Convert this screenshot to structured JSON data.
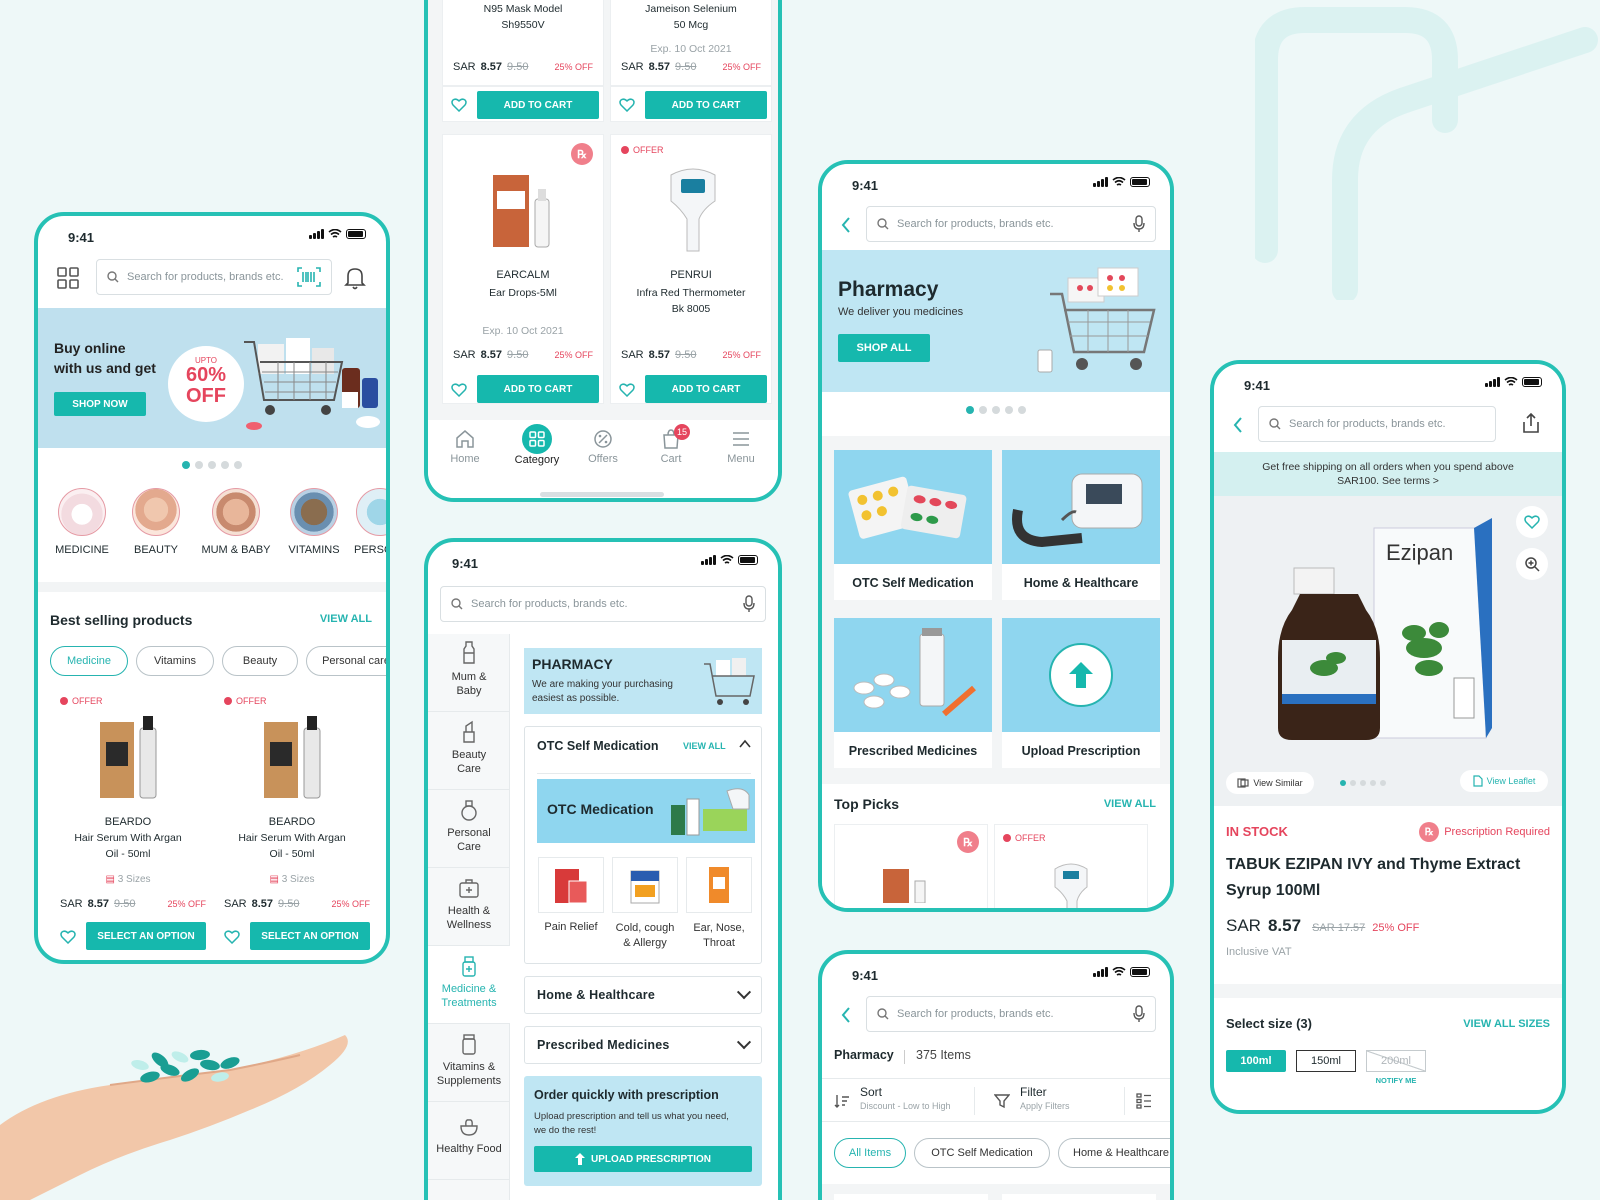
{
  "status_time": "9:41",
  "search_placeholder": "Search for products, brands etc.",
  "home": {
    "banner": {
      "line1": "Buy online",
      "line2": "with us and get",
      "upto": "UPTO",
      "pct": "60%",
      "off": "OFF",
      "button": "SHOP NOW"
    },
    "categories": [
      "MEDICINE",
      "BEAUTY",
      "MUM & BABY",
      "VITAMINS",
      "PERSO"
    ],
    "best_selling": {
      "title": "Best selling products",
      "view_all": "VIEW ALL"
    },
    "chips": [
      "Medicine",
      "Vitamins",
      "Beauty",
      "Personal care"
    ],
    "products": [
      {
        "offer": "OFFER",
        "brand": "BEARDO",
        "name1": "Hair Serum With Argan",
        "name2": "Oil - 50ml",
        "sizes": "3 Sizes",
        "currency": "SAR",
        "price": "8.57",
        "old": "9.50",
        "off": "25% OFF",
        "button": "SELECT AN OPTION"
      },
      {
        "offer": "OFFER",
        "brand": "BEARDO",
        "name1": "Hair Serum With Argan",
        "name2": "Oil - 50ml",
        "sizes": "3 Sizes",
        "currency": "SAR",
        "price": "8.57",
        "old": "9.50",
        "off": "25% OFF",
        "button": "SELECT AN OPTION"
      }
    ]
  },
  "grid": {
    "top": [
      {
        "name1": "N95 Mask Model",
        "name2": "Sh9550V",
        "exp": "",
        "currency": "SAR",
        "price": "8.57",
        "old": "9.50",
        "off": "25% OFF",
        "button": "ADD TO CART"
      },
      {
        "name1": "Jameison Selenium",
        "name2": "50 Mcg",
        "exp": "Exp. 10 Oct 2021",
        "currency": "SAR",
        "price": "8.57",
        "old": "9.50",
        "off": "25% OFF",
        "button": "ADD TO CART"
      }
    ],
    "bottom": [
      {
        "badge": "℞",
        "brand": "EARCALM",
        "name1": "Ear Drops-5Ml",
        "name2": "",
        "exp": "Exp. 10 Oct 2021",
        "currency": "SAR",
        "price": "8.57",
        "old": "9.50",
        "off": "25% OFF",
        "button": "ADD TO CART"
      },
      {
        "offer": "OFFER",
        "brand": "PENRUI",
        "name1": "Infra Red Thermometer",
        "name2": "Bk 8005",
        "exp": "",
        "currency": "SAR",
        "price": "8.57",
        "old": "9.50",
        "off": "25% OFF",
        "button": "ADD TO CART"
      }
    ],
    "nav": [
      "Home",
      "Category",
      "Offers",
      "Cart",
      "Menu"
    ],
    "cart_count": "15"
  },
  "category": {
    "sidebar": [
      {
        "l1": "Mum &",
        "l2": "Baby"
      },
      {
        "l1": "Beauty",
        "l2": "Care"
      },
      {
        "l1": "Personal",
        "l2": "Care"
      },
      {
        "l1": "Health &",
        "l2": "Wellness"
      },
      {
        "l1": "Medicine &",
        "l2": "Treatments"
      },
      {
        "l1": "Vitamins &",
        "l2": "Supplements"
      },
      {
        "l1": "Healthy Food",
        "l2": ""
      }
    ],
    "pharmacy_title": "PHARMACY",
    "pharmacy_sub1": "We are making your purchasing",
    "pharmacy_sub2": "easiest as possible.",
    "otc_header": "OTC Self Medication",
    "view_all": "VIEW ALL",
    "otc_banner": "OTC Medication",
    "subcats": [
      {
        "l1": "Pain Relief",
        "l2": ""
      },
      {
        "l1": "Cold, cough",
        "l2": "& Allergy"
      },
      {
        "l1": "Ear, Nose,",
        "l2": "Throat"
      }
    ],
    "accordion": [
      "Home & Healthcare",
      "Prescribed Medicines"
    ],
    "rx_title": "Order quickly with prescription",
    "rx_sub1": "Upload prescription and tell us what you need,",
    "rx_sub2": "we do the rest!",
    "rx_button": "UPLOAD PRESCRIPTION"
  },
  "pharmacy": {
    "title": "Pharmacy",
    "sub": "We deliver you medicines",
    "button": "SHOP ALL",
    "tiles": [
      "OTC Self Medication",
      "Home & Healthcare",
      "Prescribed Medicines",
      "Upload Prescription"
    ],
    "top_picks": "Top Picks",
    "view_all": "VIEW ALL",
    "offer": "OFFER"
  },
  "listing": {
    "title": "Pharmacy",
    "count": "375 Items",
    "sort": "Sort",
    "sort_sub": "Discount - Low to High",
    "filter": "Filter",
    "filter_sub": "Apply Filters",
    "chips": [
      "All Items",
      "OTC Self Medication",
      "Home & Healthcare"
    ]
  },
  "product": {
    "shipping1": "Get free shipping on all orders when you spend above",
    "shipping2": "SAR100. See terms >",
    "view_similar": "View Similar",
    "view_leaflet": "View Leaflet",
    "stock": "IN STOCK",
    "rx": "Prescription Required",
    "name1": "TABUK EZIPAN IVY and Thyme Extract",
    "name2": "Syrup 100Ml",
    "currency": "SAR",
    "price": "8.57",
    "old": "SAR 17.57",
    "off": "25% OFF",
    "vat": "Inclusive VAT",
    "select_size": "Select size (3)",
    "view_sizes": "VIEW ALL SIZES",
    "sizes": [
      "100ml",
      "150ml",
      "200ml"
    ],
    "notify": "NOTIFY ME",
    "brand_label": "Ezipan"
  },
  "colors": {
    "accent": "#16b8ad",
    "offer": "#e5455d",
    "banner": "#bfe6f3"
  }
}
